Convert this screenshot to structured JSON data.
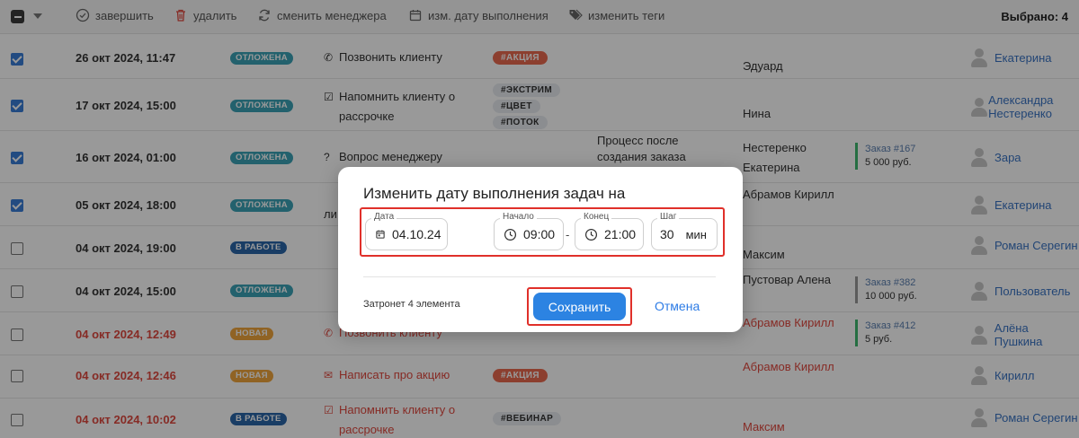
{
  "toolbar": {
    "complete_label": "завершить",
    "delete_label": "удалить",
    "change_manager_label": "сменить менеджера",
    "change_date_label": "изм. дату выполнения",
    "change_tags_label": "изменить теги",
    "selected_label": "Выбрано: 4"
  },
  "rows": [
    {
      "date": "26 окт 2024, 11:47",
      "status": "ОТЛОЖЕНА",
      "task": "Позвонить клиенту",
      "tags": [
        "#АКЦИЯ"
      ],
      "client": "Эдуард",
      "manager": "Екатерина",
      "checked": true
    },
    {
      "date": "17 окт 2024, 15:00",
      "status": "ОТЛОЖЕНА",
      "task": "Напомнить клиенту о рассрочке",
      "tags": [
        "#ЭКСТРИМ",
        "#ЦВЕТ",
        "#ПОТОК"
      ],
      "client": "Нина",
      "manager": "Александра Нестеренко",
      "checked": true
    },
    {
      "date": "16 окт 2024, 01:00",
      "status": "ОТЛОЖЕНА",
      "task": "Вопрос менеджеру",
      "desc": "Процесс после создания заказа",
      "client": "Нестеренко Екатерина",
      "order_label": "Заказ #167",
      "order_value": "5 000 руб.",
      "manager": "Зара",
      "checked": true
    },
    {
      "date": "05 окт 2024, 18:00",
      "status": "ОТЛОЖЕНА",
      "task": "ли",
      "client": "Абрамов Кирилл",
      "manager": "Екатерина",
      "checked": true
    },
    {
      "date": "04 окт 2024, 19:00",
      "status": "В РАБОТЕ",
      "task": "",
      "client": "Максим",
      "manager": "Роман Серегин",
      "checked": false
    },
    {
      "date": "04 окт 2024, 15:00",
      "status": "ОТЛОЖЕНА",
      "task": "",
      "client": "Пустовар Алена",
      "order_label": "Заказ #382",
      "order_value": "10 000 руб.",
      "manager": "Пользователь",
      "checked": false
    },
    {
      "date": "04 окт 2024, 12:49",
      "status": "НОВАЯ",
      "task": "Позвонить клиенту",
      "client": "Абрамов Кирилл",
      "order_label": "Заказ #412",
      "order_value": "5 руб.",
      "manager": "Алёна Пушкина",
      "checked": false
    },
    {
      "date": "04 окт 2024, 12:46",
      "status": "НОВАЯ",
      "task": "Написать про акцию",
      "tags": [
        "#АКЦИЯ"
      ],
      "client": "Абрамов Кирилл",
      "manager": "Кирилл",
      "checked": false
    },
    {
      "date": "04 окт 2024, 10:02",
      "status": "В РАБОТЕ",
      "task": "Напомнить клиенту о рассрочке",
      "tags": [
        "#ВЕБИНАР"
      ],
      "client": "Максим",
      "manager": "Роман Серегин",
      "checked": false
    }
  ],
  "modal": {
    "title": "Изменить дату выполнения задач на",
    "date_label": "Дата",
    "date_value": "04.10.24",
    "start_label": "Начало",
    "start_value": "09:00",
    "end_label": "Конец",
    "end_value": "21:00",
    "step_label": "Шаг",
    "step_value": "30",
    "step_unit": "мин",
    "range_sep": "-",
    "affect_text": "Затронет 4 элемента",
    "save_label": "Сохранить",
    "cancel_label": "Отмена"
  },
  "colors": {
    "accent": "#2c83e2",
    "danger": "#e0483e",
    "highlight_box": "#e0302a"
  }
}
